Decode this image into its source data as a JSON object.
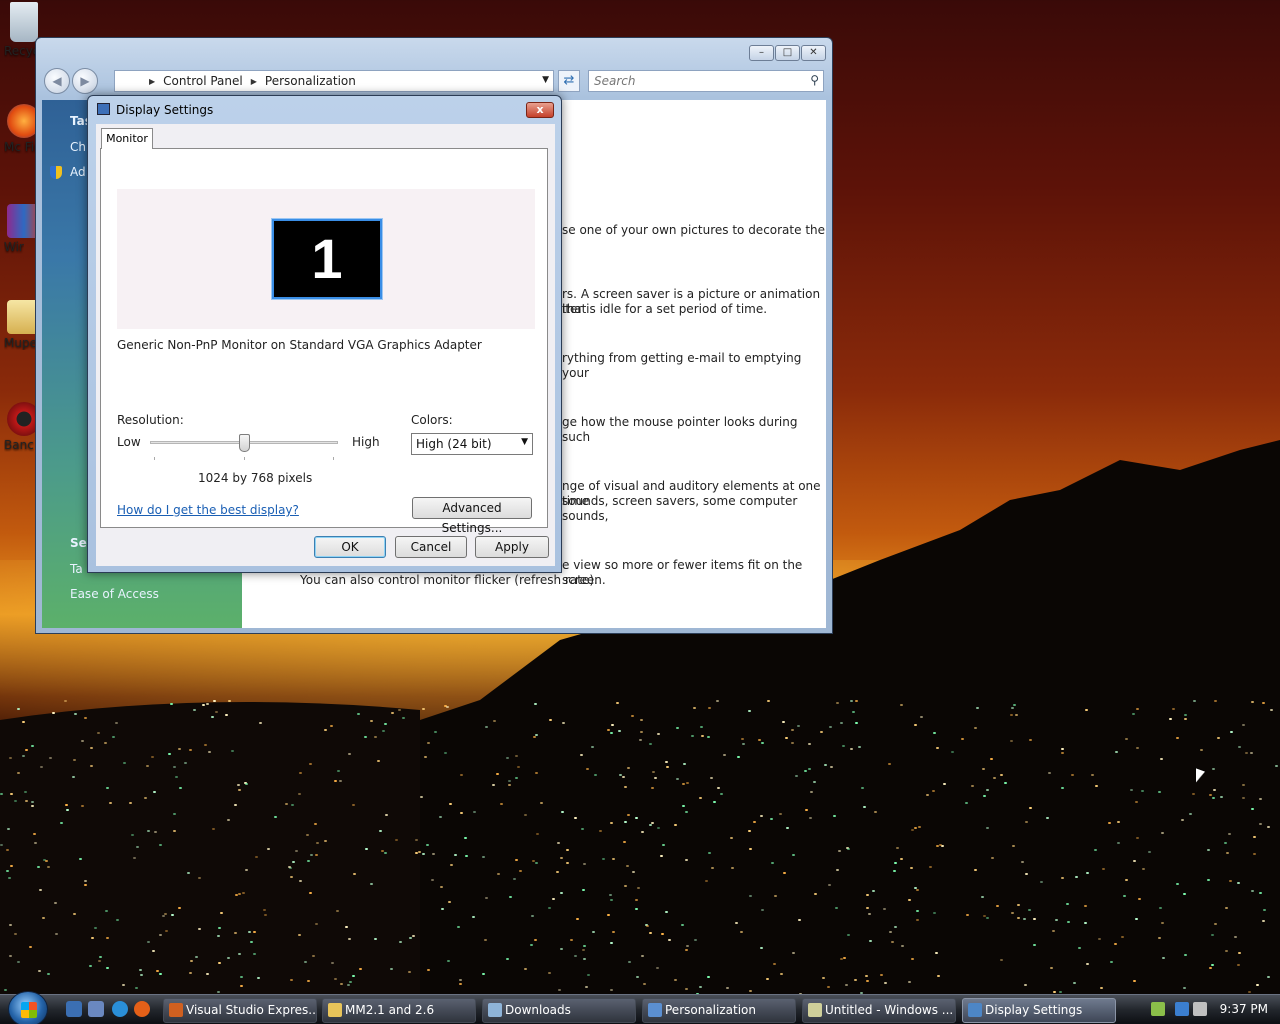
{
  "desktop": {
    "icons": [
      {
        "label": "Recyc",
        "icon": "recycle-bin-icon"
      },
      {
        "label": "Mc Fire",
        "icon": "firefox-icon"
      },
      {
        "label": "Wir",
        "icon": "winrar-icon"
      },
      {
        "label": "Mupe",
        "icon": "folder-icon"
      },
      {
        "label": "Banc",
        "icon": "bandicam-icon"
      }
    ]
  },
  "control_panel": {
    "breadcrumb": [
      "Control Panel",
      "Personalization"
    ],
    "search_placeholder": "Search",
    "left_pane": {
      "tasks_heading": "Tas",
      "items": [
        "Ch",
        "Ad"
      ],
      "see_also_heading": "Se",
      "see_also_items": [
        "Ta",
        "Ease of Access"
      ]
    },
    "descriptions": [
      "se one of your own pictures to decorate the",
      "rs. A screen saver is a picture or animation that",
      "iter is idle for a set period of time.",
      "rything from getting e-mail to emptying your",
      "ge how the mouse pointer looks during such",
      "nge of visual and auditory elements at one time",
      "sounds, screen savers, some computer sounds,",
      "e view so more or fewer items fit on the screen.",
      "You can also control monitor flicker (refresh rate)."
    ]
  },
  "display_settings": {
    "title": "Display Settings",
    "close_label": "x",
    "tab": "Monitor",
    "monitor_number": "1",
    "monitor_name": "Generic Non-PnP Monitor on Standard VGA Graphics Adapter",
    "resolution_label": "Resolution:",
    "low_label": "Low",
    "high_label": "High",
    "resolution_value": "1024 by 768 pixels",
    "resolution_level_fraction": 0.5,
    "colors_label": "Colors:",
    "colors_value": "High (24 bit)",
    "help_link": "How do I get the best display?",
    "advanced_button": "Advanced Settings...",
    "ok_button": "OK",
    "cancel_button": "Cancel",
    "apply_button": "Apply"
  },
  "taskbar": {
    "buttons": [
      {
        "label": "Visual Studio Expres...",
        "icon": "visual-studio-icon",
        "color": "#d06020"
      },
      {
        "label": "MM2.1 and 2.6",
        "icon": "folder-icon",
        "color": "#e8c45a"
      },
      {
        "label": "Downloads",
        "icon": "folder-icon",
        "color": "#8fb4d8"
      },
      {
        "label": "Personalization",
        "icon": "control-panel-icon",
        "color": "#5b8fd1"
      },
      {
        "label": "Untitled - Windows ...",
        "icon": "movie-maker-icon",
        "color": "#cfcf9a"
      },
      {
        "label": "Display Settings",
        "icon": "display-settings-icon",
        "color": "#4d86c6"
      }
    ],
    "clock": "9:37 PM"
  }
}
